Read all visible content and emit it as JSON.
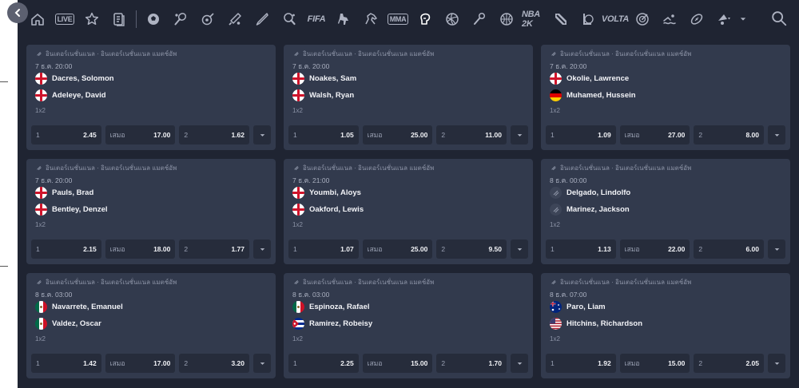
{
  "back_icon": "chevron-left-icon",
  "nav": {
    "items": [
      {
        "icon": "home-icon"
      },
      {
        "icon": "live-icon",
        "label": "LIVE"
      },
      {
        "icon": "star-icon"
      },
      {
        "icon": "betslip-icon"
      },
      {
        "icon": "soccer-icon"
      },
      {
        "icon": "tennis-icon"
      },
      {
        "icon": "esports-icon"
      },
      {
        "icon": "cricket-icon"
      },
      {
        "icon": "baseball-icon"
      },
      {
        "icon": "table-tennis-icon"
      },
      {
        "icon": "fifa-icon",
        "label": "FIFA"
      },
      {
        "icon": "counter-strike-icon"
      },
      {
        "icon": "horse-racing-icon"
      },
      {
        "icon": "mma-icon",
        "label": "MMA"
      },
      {
        "icon": "boxing-icon"
      },
      {
        "icon": "volleyball-icon"
      },
      {
        "icon": "badminton-icon"
      },
      {
        "icon": "basketball-icon"
      },
      {
        "icon": "nba2k-icon",
        "label": "NBA 2K"
      },
      {
        "icon": "dota-icon"
      },
      {
        "icon": "league-of-legends-icon"
      },
      {
        "icon": "volta-fifa-icon",
        "label": "VOLTA"
      },
      {
        "icon": "darts-icon"
      },
      {
        "icon": "swimming-icon"
      },
      {
        "icon": "rugby-icon"
      },
      {
        "icon": "more-sports-icon"
      }
    ],
    "search_icon": "search-icon"
  },
  "matches": [
    {
      "league": "อินเตอร์เนชั่นแนล · อินเตอร์เนชั่นแนล แมตช์อัพ",
      "datetime": "7 ธ.ค. 20:00",
      "home": {
        "name": "Dacres, Solomon",
        "flag": "england"
      },
      "away": {
        "name": "Adeleye, David",
        "flag": "england"
      },
      "market": "1x2",
      "odds": [
        {
          "label": "1",
          "value": "2.45"
        },
        {
          "label": "เสมอ",
          "value": "17.00"
        },
        {
          "label": "2",
          "value": "1.62"
        }
      ]
    },
    {
      "league": "อินเตอร์เนชั่นแนล · อินเตอร์เนชั่นแนล แมตช์อัพ",
      "datetime": "7 ธ.ค. 20:00",
      "home": {
        "name": "Noakes, Sam",
        "flag": "england"
      },
      "away": {
        "name": "Walsh, Ryan",
        "flag": "england"
      },
      "market": "1x2",
      "odds": [
        {
          "label": "1",
          "value": "1.05"
        },
        {
          "label": "เสมอ",
          "value": "25.00"
        },
        {
          "label": "2",
          "value": "11.00"
        }
      ]
    },
    {
      "league": "อินเตอร์เนชั่นแนล · อินเตอร์เนชั่นแนล แมตช์อัพ",
      "datetime": "7 ธ.ค. 20:00",
      "home": {
        "name": "Okolie, Lawrence",
        "flag": "england"
      },
      "away": {
        "name": "Muhamed, Hussein",
        "flag": "germany"
      },
      "market": "1x2",
      "odds": [
        {
          "label": "1",
          "value": "1.09"
        },
        {
          "label": "เสมอ",
          "value": "27.00"
        },
        {
          "label": "2",
          "value": "8.00"
        }
      ]
    },
    {
      "league": "อินเตอร์เนชั่นแนล · อินเตอร์เนชั่นแนล แมตช์อัพ",
      "datetime": "7 ธ.ค. 20:00",
      "home": {
        "name": "Pauls, Brad",
        "flag": "england"
      },
      "away": {
        "name": "Bentley, Denzel",
        "flag": "england"
      },
      "market": "1x2",
      "odds": [
        {
          "label": "1",
          "value": "2.15"
        },
        {
          "label": "เสมอ",
          "value": "18.00"
        },
        {
          "label": "2",
          "value": "1.77"
        }
      ]
    },
    {
      "league": "อินเตอร์เนชั่นแนล · อินเตอร์เนชั่นแนล แมตช์อัพ",
      "datetime": "7 ธ.ค. 21:00",
      "home": {
        "name": "Youmbi, Aloys",
        "flag": "england"
      },
      "away": {
        "name": "Oakford, Lewis",
        "flag": "england"
      },
      "market": "1x2",
      "odds": [
        {
          "label": "1",
          "value": "1.07"
        },
        {
          "label": "เสมอ",
          "value": "25.00"
        },
        {
          "label": "2",
          "value": "9.50"
        }
      ]
    },
    {
      "league": "อินเตอร์เนชั่นแนล · อินเตอร์เนชั่นแนล แมตช์อัพ",
      "datetime": "8 ธ.ค. 00:00",
      "home": {
        "name": "Delgado, Lindolfo",
        "flag": "none"
      },
      "away": {
        "name": "Marinez, Jackson",
        "flag": "none"
      },
      "market": "1x2",
      "odds": [
        {
          "label": "1",
          "value": "1.13"
        },
        {
          "label": "เสมอ",
          "value": "22.00"
        },
        {
          "label": "2",
          "value": "6.00"
        }
      ]
    },
    {
      "league": "อินเตอร์เนชั่นแนล · อินเตอร์เนชั่นแนล แมตช์อัพ",
      "datetime": "8 ธ.ค. 03:00",
      "home": {
        "name": "Navarrete, Emanuel",
        "flag": "mexico"
      },
      "away": {
        "name": "Valdez, Oscar",
        "flag": "mexico"
      },
      "market": "1x2",
      "odds": [
        {
          "label": "1",
          "value": "1.42"
        },
        {
          "label": "เสมอ",
          "value": "17.00"
        },
        {
          "label": "2",
          "value": "3.20"
        }
      ]
    },
    {
      "league": "อินเตอร์เนชั่นแนล · อินเตอร์เนชั่นแนล แมตช์อัพ",
      "datetime": "8 ธ.ค. 03:00",
      "home": {
        "name": "Espinoza, Rafael",
        "flag": "mexico"
      },
      "away": {
        "name": "Ramirez, Robeisy",
        "flag": "cuba"
      },
      "market": "1x2",
      "odds": [
        {
          "label": "1",
          "value": "2.25"
        },
        {
          "label": "เสมอ",
          "value": "15.00"
        },
        {
          "label": "2",
          "value": "1.70"
        }
      ]
    },
    {
      "league": "อินเตอร์เนชั่นแนล · อินเตอร์เนชั่นแนล แมตช์อัพ",
      "datetime": "8 ธ.ค. 07:00",
      "home": {
        "name": "Paro, Liam",
        "flag": "australia"
      },
      "away": {
        "name": "Hitchins, Richardson",
        "flag": "usa"
      },
      "market": "1x2",
      "odds": [
        {
          "label": "1",
          "value": "1.92"
        },
        {
          "label": "เสมอ",
          "value": "15.00"
        },
        {
          "label": "2",
          "value": "2.05"
        }
      ]
    }
  ],
  "colors": {
    "background": "#1f2432",
    "card": "#323a4d",
    "odd_cell": "#262c3b",
    "muted": "#8c93a6"
  }
}
